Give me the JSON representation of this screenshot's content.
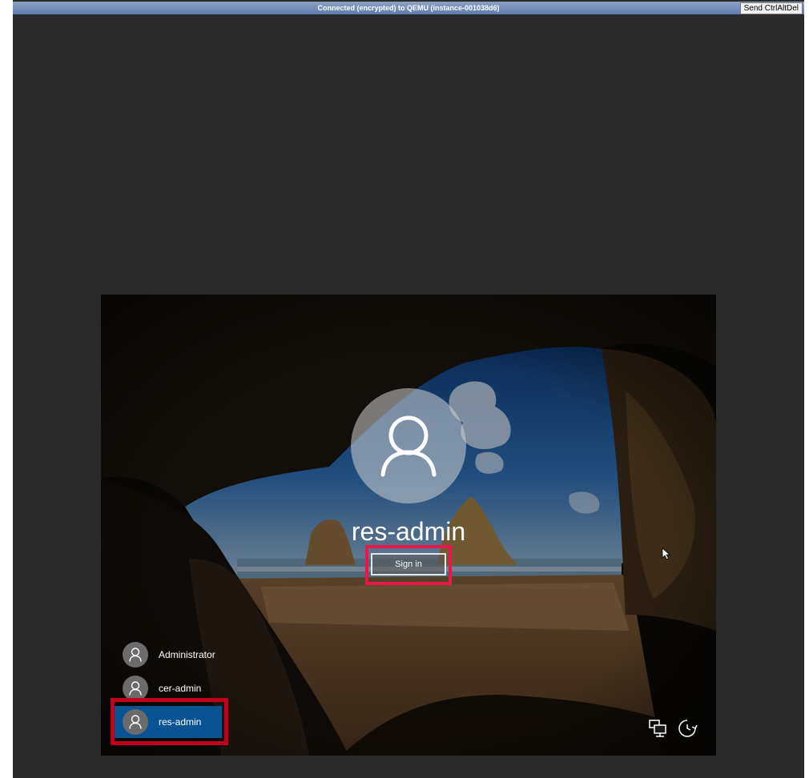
{
  "vnc": {
    "status": "Connected (encrypted) to QEMU (instance-001038d6)",
    "send_cad_label": "Send CtrlAltDel"
  },
  "login": {
    "selected_user": "res-admin",
    "signin_label": "Sign in",
    "users": [
      {
        "name": "Administrator"
      },
      {
        "name": "cer-admin"
      },
      {
        "name": "res-admin",
        "selected": true
      }
    ]
  },
  "icons": {
    "network": "network-icon",
    "ease_of_access": "ease-of-access-icon",
    "user": "user-silhouette-icon"
  },
  "colors": {
    "selected_user_bg": "#0a5393",
    "highlight_pink": "#e8194a",
    "highlight_red": "#c0001a"
  }
}
